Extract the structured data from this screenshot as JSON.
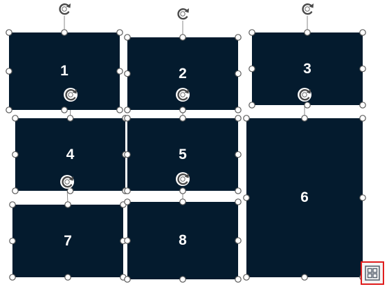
{
  "slide": {
    "shapes": [
      {
        "id": "1",
        "label": "1"
      },
      {
        "id": "2",
        "label": "2"
      },
      {
        "id": "3",
        "label": "3"
      },
      {
        "id": "4",
        "label": "4"
      },
      {
        "id": "5",
        "label": "5"
      },
      {
        "id": "6",
        "label": "6"
      },
      {
        "id": "7",
        "label": "7"
      },
      {
        "id": "8",
        "label": "8"
      }
    ]
  },
  "layout_options_button": {
    "icon": "design-ideas-grid-icon"
  },
  "colors": {
    "shape_fill": "#041b2e",
    "shape_text": "#ffffff",
    "handle_fill": "#ffffff",
    "handle_stroke": "#5b5b5b",
    "highlight": "#e01d1d"
  }
}
